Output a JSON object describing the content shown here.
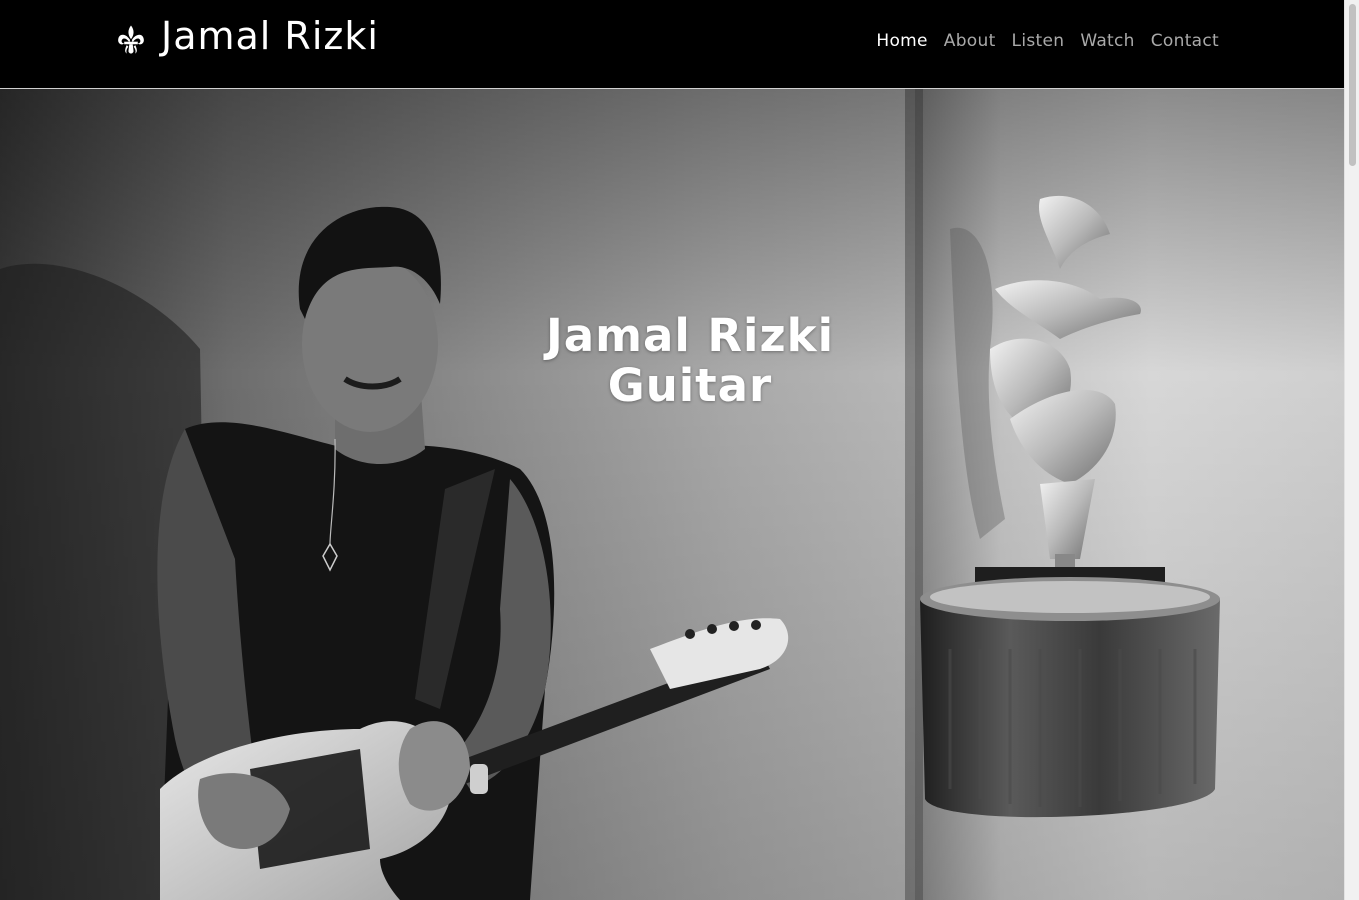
{
  "header": {
    "brand_name": "Jamal Rizki",
    "brand_icon": "fleur-de-lis-icon",
    "nav": [
      {
        "label": "Home",
        "active": true
      },
      {
        "label": "About",
        "active": false
      },
      {
        "label": "Listen",
        "active": false
      },
      {
        "label": "Watch",
        "active": false
      },
      {
        "label": "Contact",
        "active": false
      }
    ]
  },
  "hero": {
    "title_line1": "Jamal Rizki",
    "title_line2": "Guitar",
    "image": "black-and-white photo of guitarist with electric guitar beside sculpture"
  },
  "colors": {
    "header_bg": "#000000",
    "nav_active": "#ffffff",
    "nav_inactive": "#a9a9a9"
  }
}
